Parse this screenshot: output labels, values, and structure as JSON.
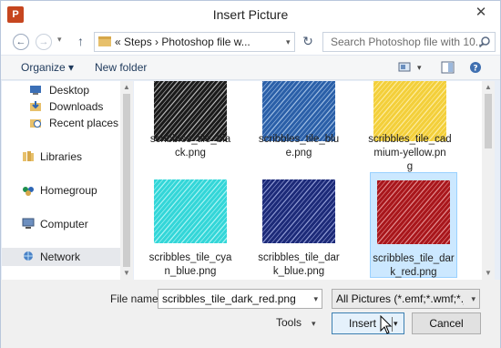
{
  "window": {
    "title": "Insert Picture",
    "app_icon": "P",
    "close_glyph": "✕"
  },
  "nav": {
    "back_glyph": "←",
    "forward_glyph": "→",
    "dropdown_glyph": "▾",
    "up_glyph": "↑",
    "address": "« Steps › Photoshop file w...",
    "refresh_glyph": "↻",
    "search_placeholder": "Search Photoshop file with 10..."
  },
  "toolbar": {
    "organize": "Organize ▾",
    "new_folder": "New folder",
    "view_icon": "view-icon",
    "preview_icon": "preview-pane-icon",
    "help_icon": "help-icon"
  },
  "sidebar": {
    "items": [
      {
        "label": "Desktop",
        "icon": "desktop-icon"
      },
      {
        "label": "Downloads",
        "icon": "downloads-icon"
      },
      {
        "label": "Recent places",
        "icon": "recent-places-icon"
      },
      {
        "label": "Libraries",
        "icon": "libraries-icon"
      },
      {
        "label": "Homegroup",
        "icon": "homegroup-icon"
      },
      {
        "label": "Computer",
        "icon": "computer-icon"
      },
      {
        "label": "Network",
        "icon": "network-icon"
      }
    ]
  },
  "files": [
    {
      "line1": "scribbles_tile_bla",
      "line2": "ck.png",
      "line3": "",
      "color": "#1a1a1a",
      "stroke": "#d8d8d8"
    },
    {
      "line1": "scribbles_tile_blu",
      "line2": "e.png",
      "line3": "",
      "color": "#2a5fa8",
      "stroke": "#b8d2f0"
    },
    {
      "line1": "scribbles_tile_cad",
      "line2": "mium-yellow.pn",
      "line3": "g",
      "color": "#f3cf3a",
      "stroke": "#fff3b8"
    },
    {
      "line1": "scribbles_tile_cya",
      "line2": "n_blue.png",
      "line3": "",
      "color": "#33d6d8",
      "stroke": "#c8fbfb"
    },
    {
      "line1": "scribbles_tile_dar",
      "line2": "k_blue.png",
      "line3": "",
      "color": "#1c2a78",
      "stroke": "#aab4e8"
    },
    {
      "line1": "scribbles_tile_dar",
      "line2": "k_red.png",
      "line3": "",
      "color": "#a8161b",
      "stroke": "#f0a8aa"
    }
  ],
  "bottom": {
    "file_name_label": "File name:",
    "file_name_value": "scribbles_tile_dark_red.png",
    "filter_value": "All Pictures (*.emf;*.wmf;*.jpg;*",
    "tools_label": "Tools",
    "insert_label": "Insert",
    "cancel_label": "Cancel",
    "dropdown_glyph": "▾"
  }
}
